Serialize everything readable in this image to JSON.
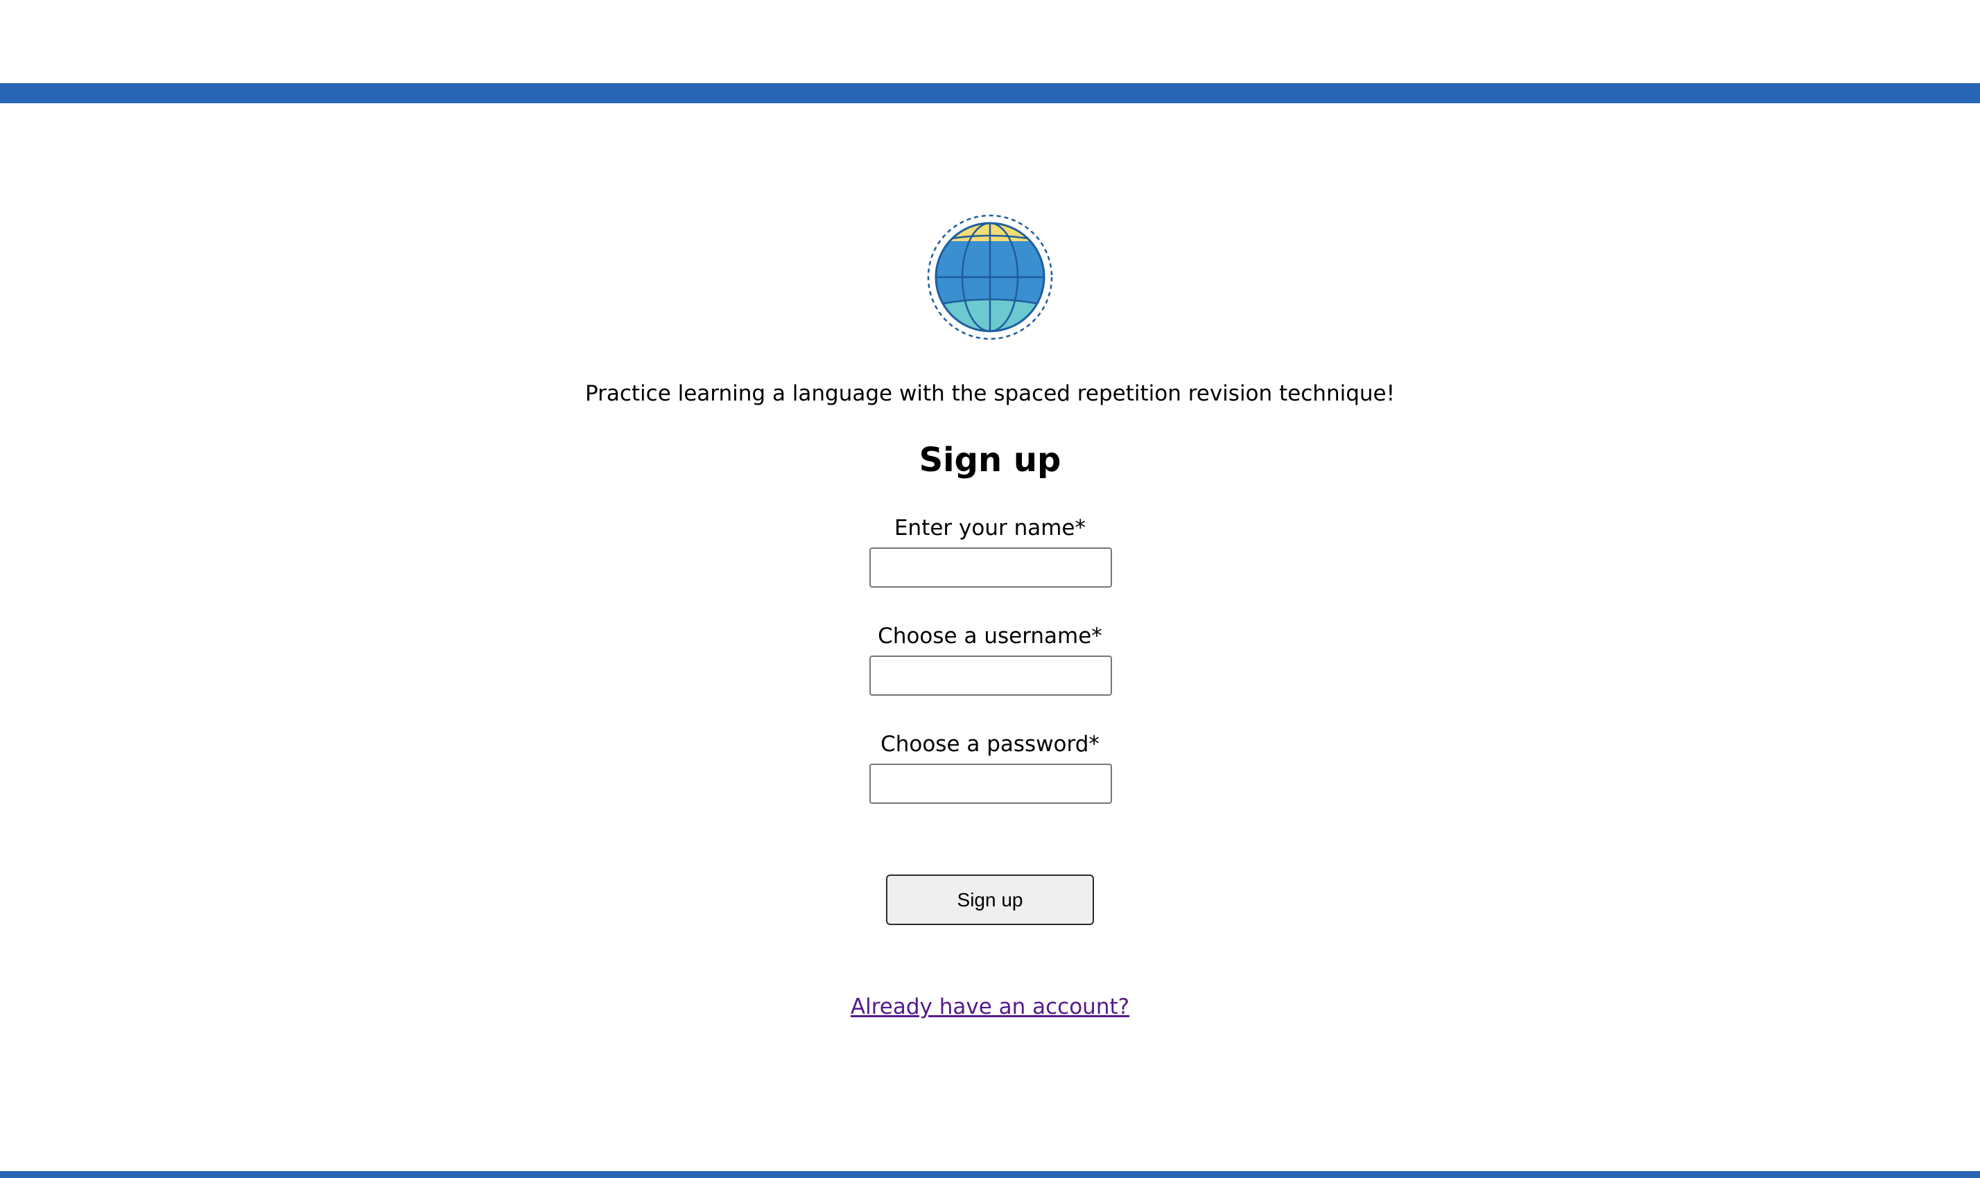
{
  "header": {
    "accent_color": "#2866b5"
  },
  "logo": {
    "icon": "globe-icon",
    "colors": {
      "ocean": "#3a8fd0",
      "north_cap": "#f5dc74",
      "south_cap": "#6cc9cf",
      "lines": "#1e5e9e"
    }
  },
  "main": {
    "tagline": "Practice learning a language with the spaced repetition revision technique!",
    "title": "Sign up",
    "fields": {
      "name": {
        "label": "Enter your name*",
        "value": "",
        "placeholder": ""
      },
      "username": {
        "label": "Choose a username*",
        "value": "",
        "placeholder": ""
      },
      "password": {
        "label": "Choose a password*",
        "value": "",
        "placeholder": ""
      }
    },
    "submit_label": "Sign up",
    "login_link": "Already have an account?"
  }
}
